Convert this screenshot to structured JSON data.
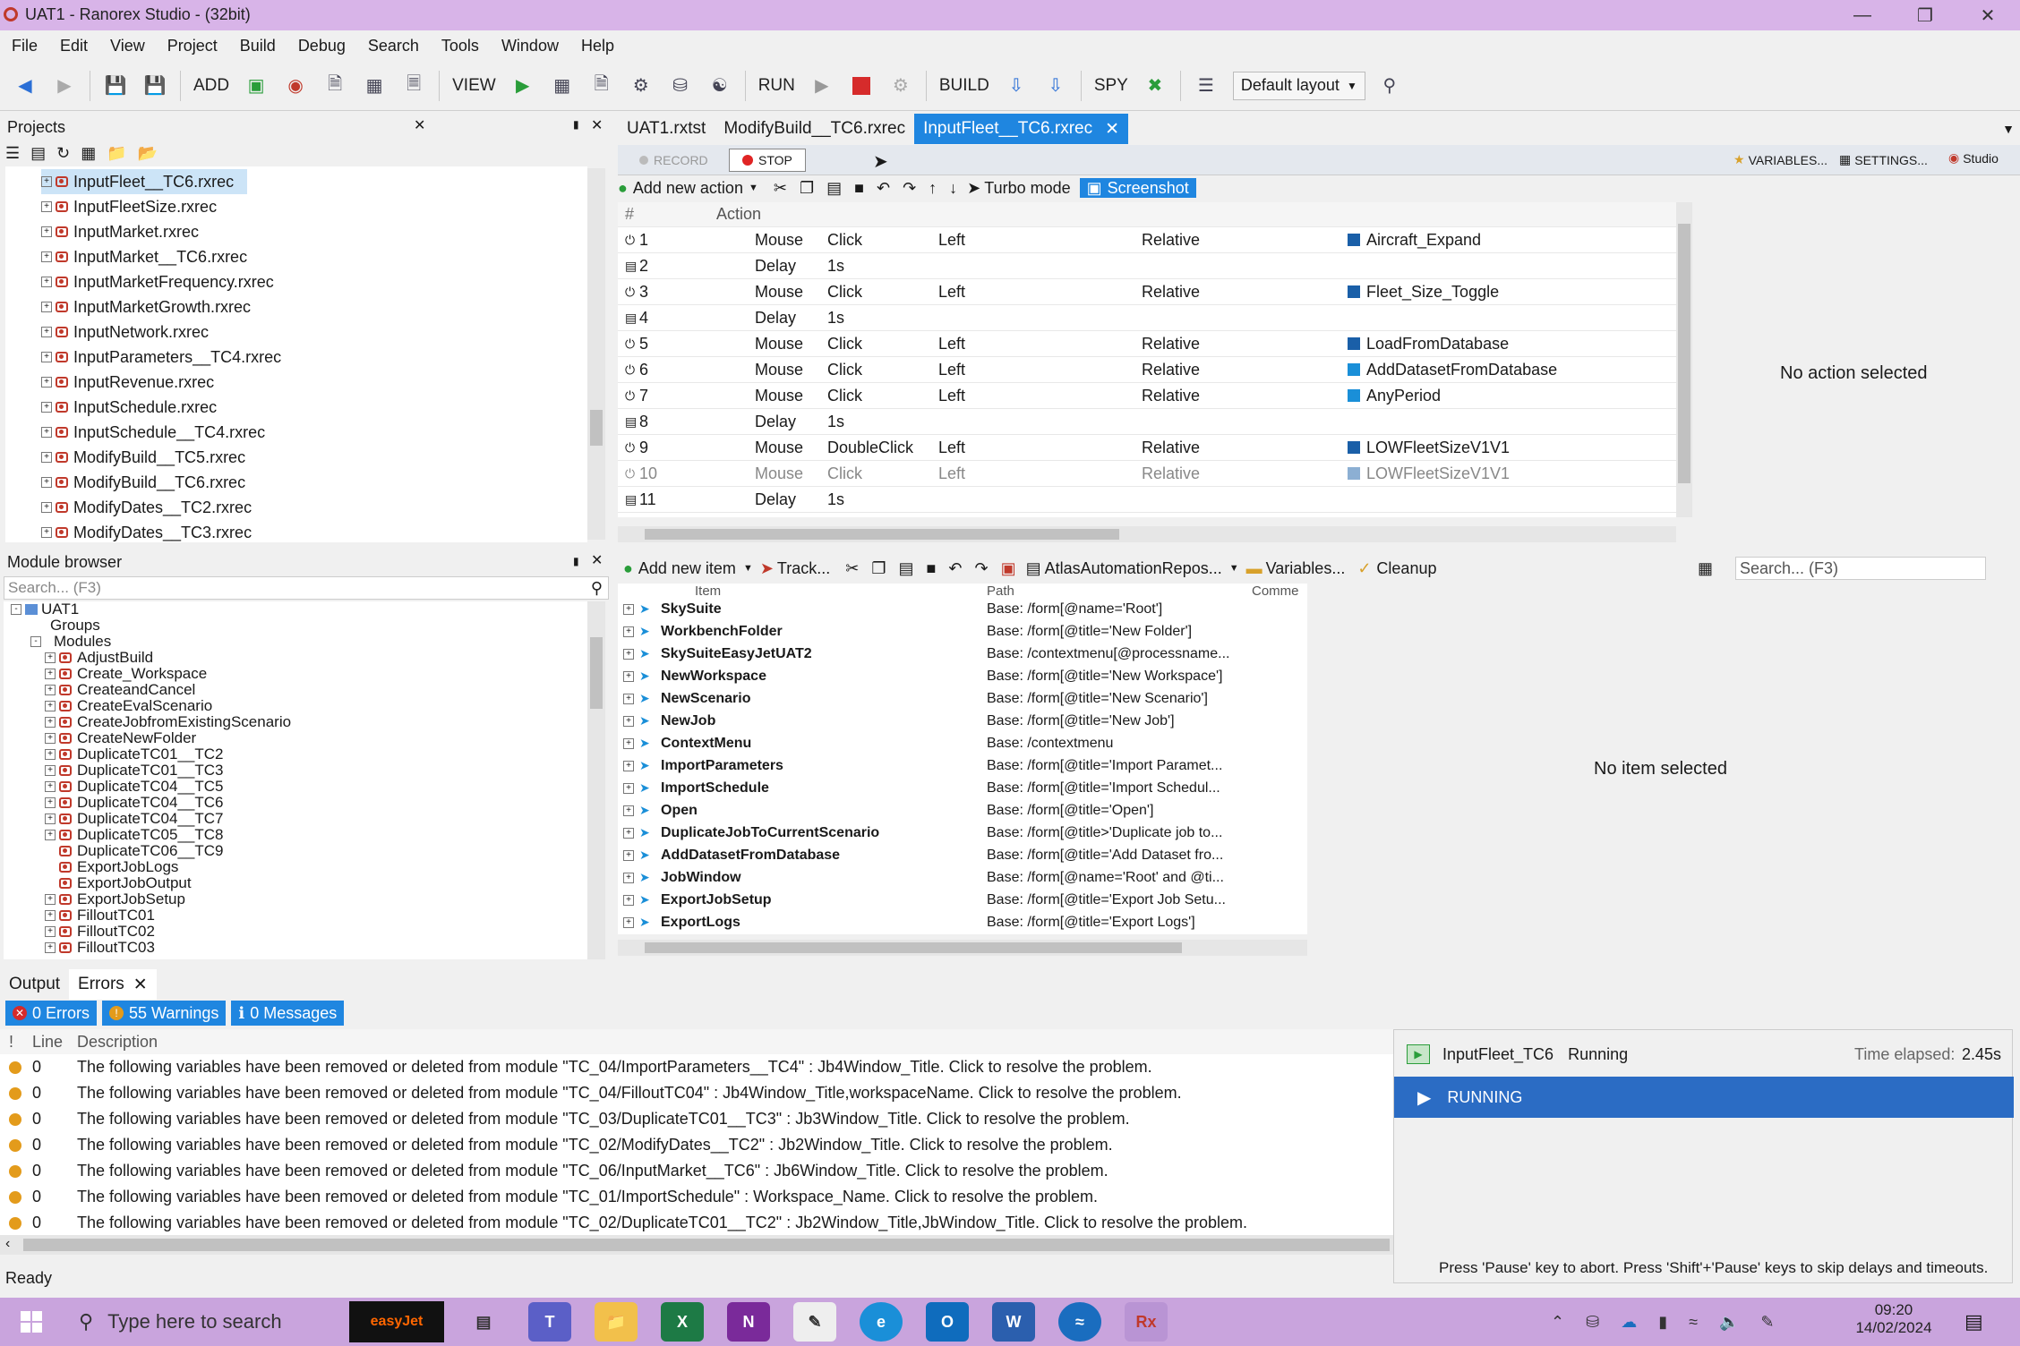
{
  "window": {
    "title": "UAT1 - Ranorex Studio - (32bit)"
  },
  "menu": [
    "File",
    "Edit",
    "View",
    "Project",
    "Build",
    "Debug",
    "Search",
    "Tools",
    "Window",
    "Help"
  ],
  "toolbar": {
    "add": "ADD",
    "view": "VIEW",
    "run": "RUN",
    "build": "BUILD",
    "spy": "SPY",
    "layout": "Default layout"
  },
  "projects": {
    "title": "Projects",
    "items": [
      "InputFleet__TC6.rxrec",
      "InputFleetSize.rxrec",
      "InputMarket.rxrec",
      "InputMarket__TC6.rxrec",
      "InputMarketFrequency.rxrec",
      "InputMarketGrowth.rxrec",
      "InputNetwork.rxrec",
      "InputParameters__TC4.rxrec",
      "InputRevenue.rxrec",
      "InputSchedule.rxrec",
      "InputSchedule__TC4.rxrec",
      "ModifyBuild__TC5.rxrec",
      "ModifyBuild__TC6.rxrec",
      "ModifyDates__TC2.rxrec",
      "ModifyDates__TC3.rxrec"
    ]
  },
  "module_browser": {
    "title": "Module browser",
    "search": "Search... (F3)",
    "root": "UAT1",
    "groups": "Groups",
    "modules": "Modules",
    "items": [
      "AdjustBuild",
      "Create_Workspace",
      "CreateandCancel",
      "CreateEvalScenario",
      "CreateJobfromExistingScenario",
      "CreateNewFolder",
      "DuplicateTC01__TC2",
      "DuplicateTC01__TC3",
      "DuplicateTC04__TC5",
      "DuplicateTC04__TC6",
      "DuplicateTC04__TC7",
      "DuplicateTC05__TC8",
      "DuplicateTC06__TC9",
      "ExportJobLogs",
      "ExportJobOutput",
      "ExportJobSetup",
      "FilloutTC01",
      "FilloutTC02",
      "FilloutTC03"
    ]
  },
  "tabs": [
    "UAT1.rxtst",
    "ModifyBuild__TC6.rxrec",
    "InputFleet__TC6.rxrec"
  ],
  "recorder": {
    "record": "RECORD",
    "stop": "STOP",
    "variables": "VARIABLES...",
    "settings": "SETTINGS...",
    "studio": "Studio",
    "add_action": "Add new action",
    "turbo": "Turbo mode",
    "screenshot": "Screenshot",
    "col_num": "#",
    "col_action": "Action",
    "no_action": "No action selected"
  },
  "actions": [
    {
      "n": "1",
      "a": "Mouse",
      "b": "Click",
      "c": "Left",
      "d": "Relative",
      "e": "Aircraft_Expand"
    },
    {
      "n": "2",
      "a": "Delay",
      "b": "1s",
      "c": "",
      "d": "",
      "e": ""
    },
    {
      "n": "3",
      "a": "Mouse",
      "b": "Click",
      "c": "Left",
      "d": "Relative",
      "e": "Fleet_Size_Toggle"
    },
    {
      "n": "4",
      "a": "Delay",
      "b": "1s",
      "c": "",
      "d": "",
      "e": ""
    },
    {
      "n": "5",
      "a": "Mouse",
      "b": "Click",
      "c": "Left",
      "d": "Relative",
      "e": "LoadFromDatabase"
    },
    {
      "n": "6",
      "a": "Mouse",
      "b": "Click",
      "c": "Left",
      "d": "Relative",
      "e": "AddDatasetFromDatabase"
    },
    {
      "n": "7",
      "a": "Mouse",
      "b": "Click",
      "c": "Left",
      "d": "Relative",
      "e": "AnyPeriod"
    },
    {
      "n": "8",
      "a": "Delay",
      "b": "1s",
      "c": "",
      "d": "",
      "e": ""
    },
    {
      "n": "9",
      "a": "Mouse",
      "b": "DoubleClick",
      "c": "Left",
      "d": "Relative",
      "e": "LOWFleetSizeV1V1"
    },
    {
      "n": "10",
      "a": "Mouse",
      "b": "Click",
      "c": "Left",
      "d": "Relative",
      "e": "LOWFleetSizeV1V1"
    },
    {
      "n": "11",
      "a": "Delay",
      "b": "1s",
      "c": "",
      "d": "",
      "e": ""
    }
  ],
  "repository": {
    "add_item": "Add new item",
    "track": "Track...",
    "repo": "AtlasAutomationRepos...",
    "variables": "Variables...",
    "cleanup": "Cleanup",
    "search": "Search... (F3)",
    "col_item": "Item",
    "col_path": "Path",
    "col_comment": "Comme",
    "no_item": "No item selected"
  },
  "repo_items": [
    {
      "i": "SkySuite",
      "p": "Base: /form[@name='Root']"
    },
    {
      "i": "WorkbenchFolder",
      "p": "Base: /form[@title='New Folder']"
    },
    {
      "i": "SkySuiteEasyJetUAT2",
      "p": "Base: /contextmenu[@processname..."
    },
    {
      "i": "NewWorkspace",
      "p": "Base: /form[@title='New Workspace']"
    },
    {
      "i": "NewScenario",
      "p": "Base: /form[@title='New Scenario']"
    },
    {
      "i": "NewJob",
      "p": "Base: /form[@title='New Job']"
    },
    {
      "i": "ContextMenu",
      "p": "Base: /contextmenu"
    },
    {
      "i": "ImportParameters",
      "p": "Base: /form[@title='Import Paramet..."
    },
    {
      "i": "ImportSchedule",
      "p": "Base: /form[@title='Import Schedul..."
    },
    {
      "i": "Open",
      "p": "Base: /form[@title='Open']"
    },
    {
      "i": "DuplicateJobToCurrentScenario",
      "p": "Base: /form[@title>'Duplicate job to..."
    },
    {
      "i": "AddDatasetFromDatabase",
      "p": "Base: /form[@title='Add Dataset fro..."
    },
    {
      "i": "JobWindow",
      "p": "Base: /form[@name='Root' and @ti..."
    },
    {
      "i": "ExportJobSetup",
      "p": "Base: /form[@title='Export Job Setu..."
    },
    {
      "i": "ExportLogs",
      "p": "Base: /form[@title='Export Logs']"
    }
  ],
  "output": {
    "tab_output": "Output",
    "tab_errors": "Errors",
    "errors": "0 Errors",
    "warnings": "55 Warnings",
    "messages": "0 Messages",
    "col_line": "Line",
    "col_desc": "Description"
  },
  "errors": [
    {
      "line": "0",
      "desc": "The following variables have been removed or deleted from module \"TC_04/ImportParameters__TC4\" : Jb4Window_Title. Click to resolve the problem."
    },
    {
      "line": "0",
      "desc": "The following variables have been removed or deleted from module \"TC_04/FilloutTC04\" : Jb4Window_Title,workspaceName. Click to resolve the problem."
    },
    {
      "line": "0",
      "desc": "The following variables have been removed or deleted from module \"TC_03/DuplicateTC01__TC3\" : Jb3Window_Title. Click to resolve the problem."
    },
    {
      "line": "0",
      "desc": "The following variables have been removed or deleted from module \"TC_02/ModifyDates__TC2\" : Jb2Window_Title. Click to resolve the problem."
    },
    {
      "line": "0",
      "desc": "The following variables have been removed or deleted from module \"TC_06/InputMarket__TC6\" : Jb6Window_Title. Click to resolve the problem."
    },
    {
      "line": "0",
      "desc": "The following variables have been removed or deleted from module \"TC_01/ImportSchedule\" : Workspace_Name. Click to resolve the problem."
    },
    {
      "line": "0",
      "desc": "The following variables have been removed or deleted from module \"TC_02/DuplicateTC01__TC2\" : Jb2Window_Title,JbWindow_Title. Click to resolve the problem."
    }
  ],
  "runner": {
    "name": "InputFleet_TC6",
    "state": "Running",
    "elapsed_label": "Time elapsed:",
    "elapsed": "2.45s",
    "running": "RUNNING",
    "hint": "Press 'Pause' key to abort. Press 'Shift'+'Pause' keys to skip delays and timeouts."
  },
  "status": {
    "text": "Ready"
  },
  "taskbar": {
    "search": "Type here to search",
    "time": "09:20",
    "date": "14/02/2024",
    "easyjet": "easyJet"
  }
}
